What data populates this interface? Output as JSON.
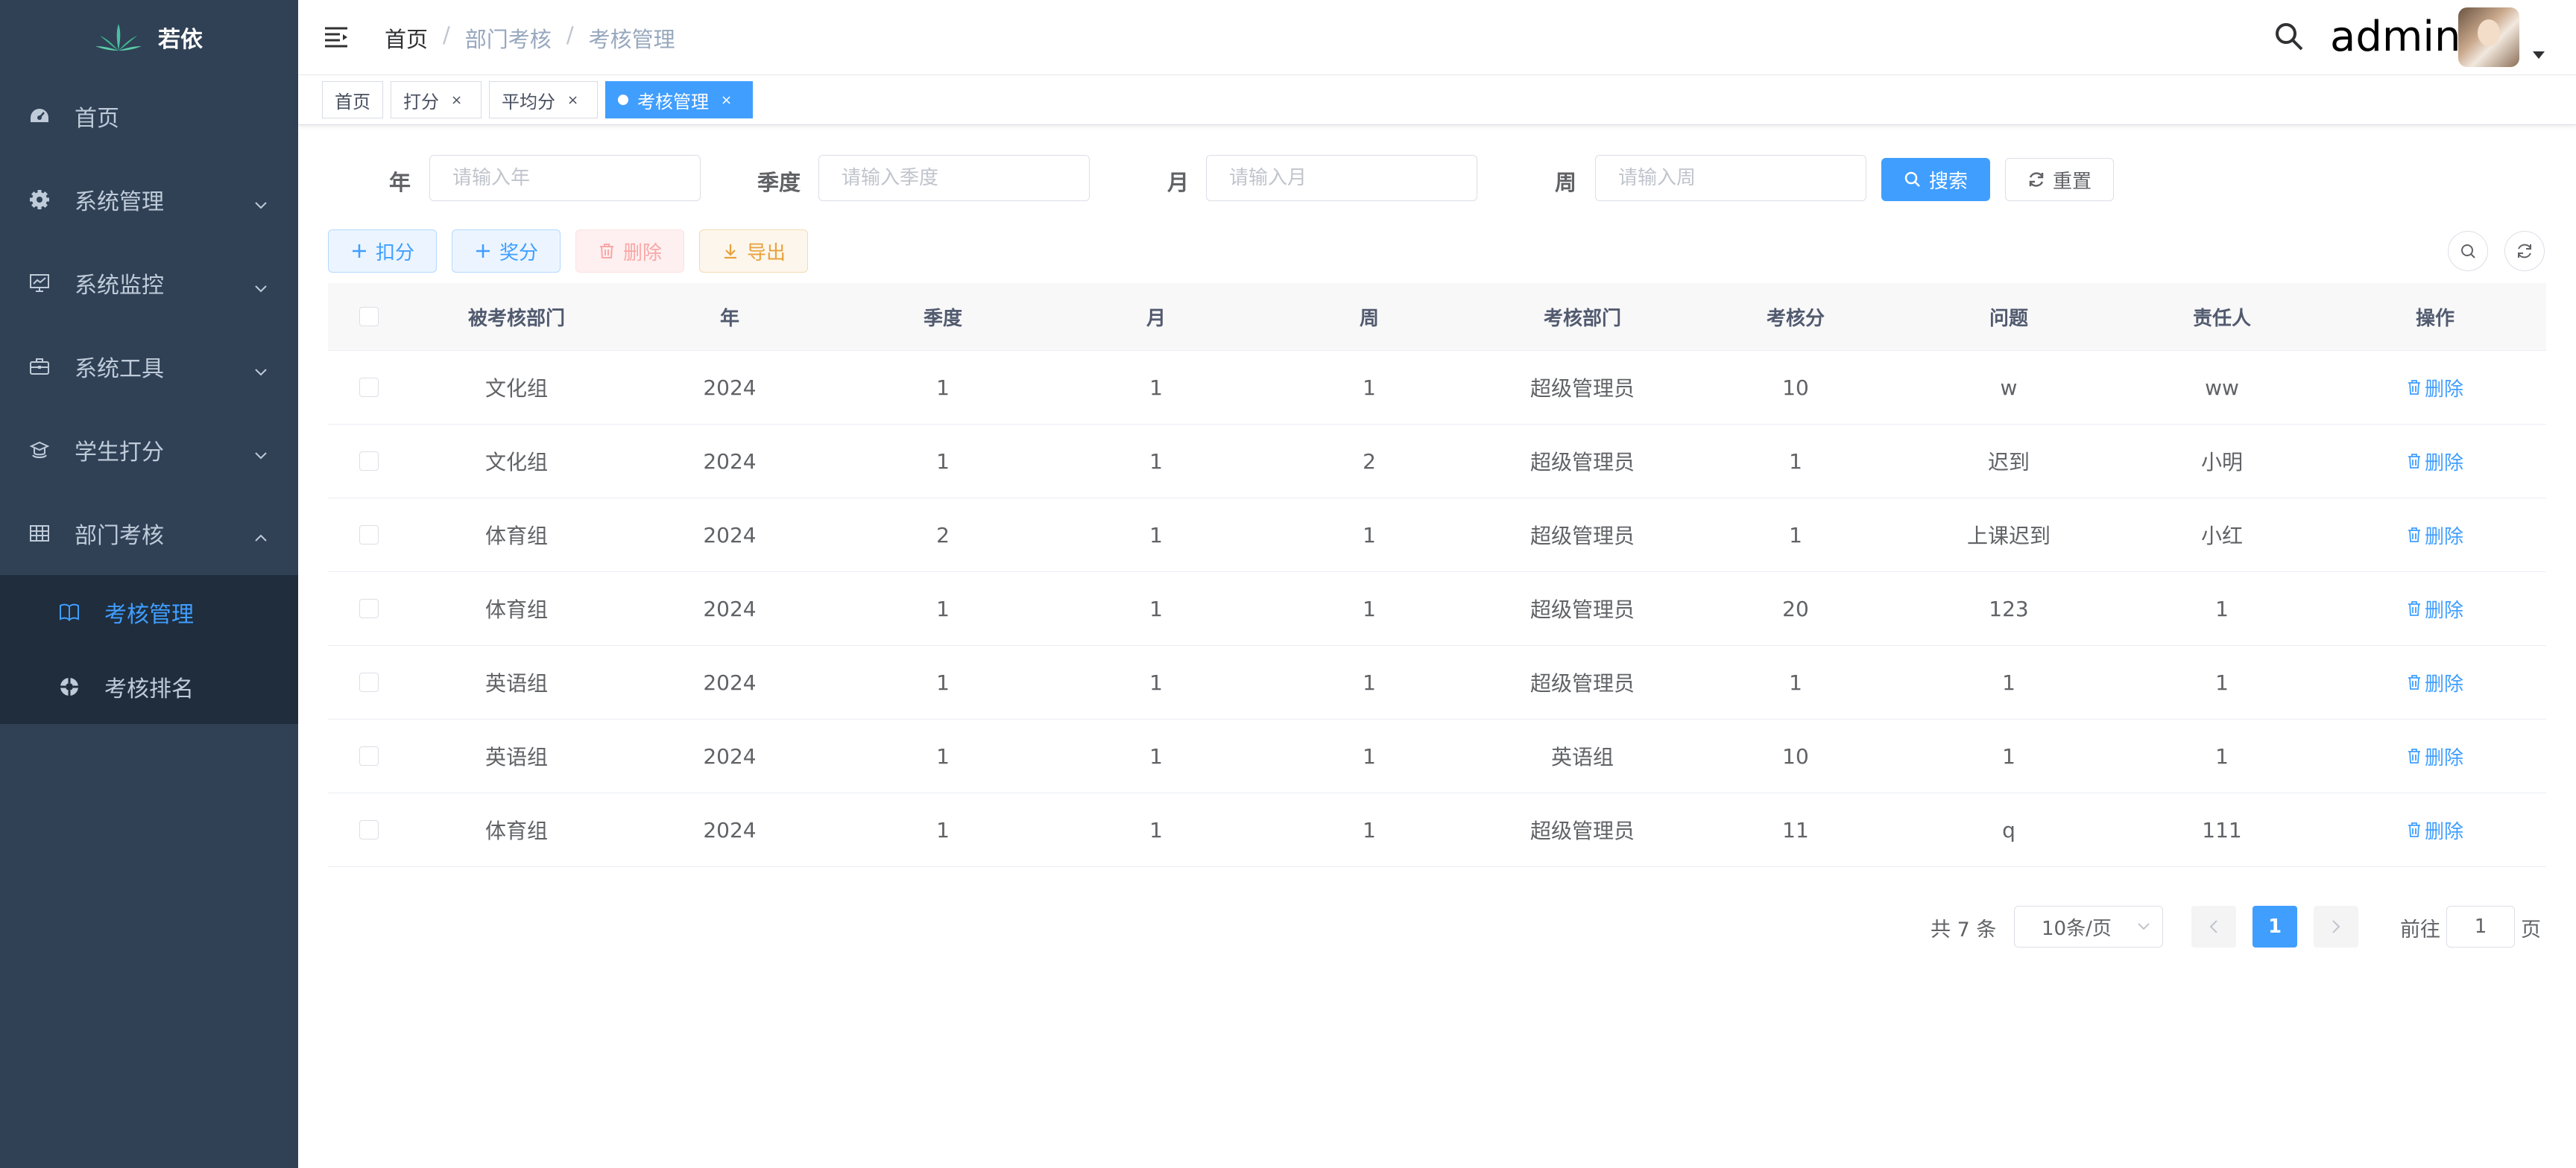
{
  "app": {
    "title": "若依"
  },
  "sidebar": {
    "items": [
      {
        "label": "首页",
        "icon": "dashboard-icon"
      },
      {
        "label": "系统管理",
        "icon": "gear-icon"
      },
      {
        "label": "系统监控",
        "icon": "monitor-icon"
      },
      {
        "label": "系统工具",
        "icon": "toolbox-icon"
      },
      {
        "label": "学生打分",
        "icon": "student-icon"
      },
      {
        "label": "部门考核",
        "icon": "table-icon"
      }
    ],
    "submenu": [
      {
        "label": "考核管理",
        "icon": "book-icon",
        "active": true
      },
      {
        "label": "考核排名",
        "icon": "ranking-icon",
        "active": false
      }
    ]
  },
  "navbar": {
    "breadcrumb": [
      "首页",
      "部门考核",
      "考核管理"
    ],
    "separator": "/",
    "username": "admin"
  },
  "tags": [
    {
      "label": "首页",
      "closable": false
    },
    {
      "label": "打分",
      "closable": true
    },
    {
      "label": "平均分",
      "closable": true
    },
    {
      "label": "考核管理",
      "closable": true,
      "active": true
    }
  ],
  "tag_close": "×",
  "search": {
    "year_label": "年",
    "year_placeholder": "请输入年",
    "quarter_label": "季度",
    "quarter_placeholder": "请输入季度",
    "month_label": "月",
    "month_placeholder": "请输入月",
    "week_label": "周",
    "week_placeholder": "请输入周",
    "search_button": "搜索",
    "reset_button": "重置"
  },
  "toolbar": {
    "deduct": "扣分",
    "reward": "奖分",
    "delete": "删除",
    "export": "导出"
  },
  "table": {
    "headers": [
      "被考核部门",
      "年",
      "季度",
      "月",
      "周",
      "考核部门",
      "考核分",
      "问题",
      "责任人",
      "操作"
    ],
    "action_label": "删除",
    "rows": [
      [
        "文化组",
        "2024",
        "1",
        "1",
        "1",
        "超级管理员",
        "10",
        "w",
        "ww"
      ],
      [
        "文化组",
        "2024",
        "1",
        "1",
        "2",
        "超级管理员",
        "1",
        "迟到",
        "小明"
      ],
      [
        "体育组",
        "2024",
        "2",
        "1",
        "1",
        "超级管理员",
        "1",
        "上课迟到",
        "小红"
      ],
      [
        "体育组",
        "2024",
        "1",
        "1",
        "1",
        "超级管理员",
        "20",
        "123",
        "1"
      ],
      [
        "英语组",
        "2024",
        "1",
        "1",
        "1",
        "超级管理员",
        "1",
        "1",
        "1"
      ],
      [
        "英语组",
        "2024",
        "1",
        "1",
        "1",
        "英语组",
        "10",
        "1",
        "1"
      ],
      [
        "体育组",
        "2024",
        "1",
        "1",
        "1",
        "超级管理员",
        "11",
        "q",
        "111"
      ]
    ]
  },
  "pagination": {
    "total_text": "共 7 条",
    "page_size": "10条/页",
    "current_page": "1",
    "goto_prefix": "前往",
    "goto_value": "1",
    "goto_suffix": "页"
  },
  "colors": {
    "sidebar": "#304156",
    "submenu": "#1f2d3d",
    "primary": "#409eff"
  }
}
